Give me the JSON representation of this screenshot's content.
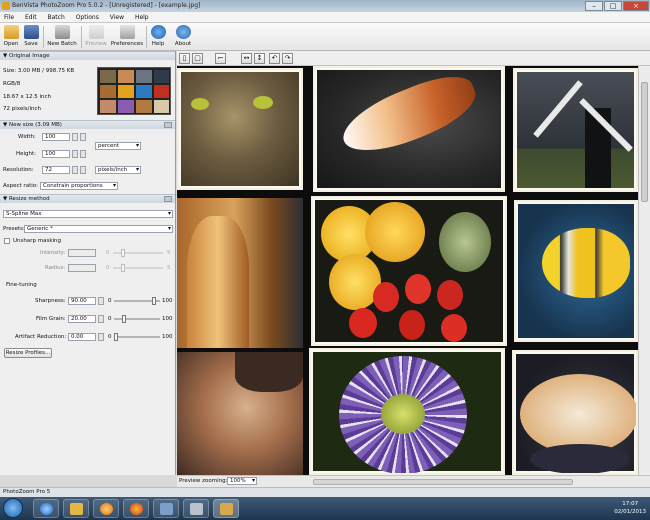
{
  "window": {
    "title": "BenVista PhotoZoom Pro 5.0.2 - [Unregistered] - [example.jpg]"
  },
  "menu": [
    "File",
    "Edit",
    "Batch",
    "Options",
    "View",
    "Help"
  ],
  "toolbar": {
    "open": "Open",
    "save": "Save",
    "new_batch": "New Batch",
    "preview": "Preview",
    "preferences": "Preferences",
    "help": "Help",
    "about": "About"
  },
  "original_image": {
    "header": "Original Image",
    "size": "Size: 3.00 MB / 998.75 KB",
    "mode": "RGB/8",
    "dimensions": "18.67 x 12.5 inch",
    "resolution": "72 pixels/inch"
  },
  "new_size": {
    "header": "New size (3.09 MB)",
    "width_label": "Width:",
    "width_value": "100",
    "width_unit": "percent",
    "height_label": "Height:",
    "height_value": "100",
    "resolution_label": "Resolution:",
    "resolution_value": "72",
    "resolution_unit": "pixels/inch",
    "aspect_label": "Aspect ratio:",
    "aspect_value": "Constrain proportions"
  },
  "resize_method": {
    "header": "Resize method",
    "method": "S-Spline Max",
    "presets_label": "Presets:",
    "presets_value": "Generic *",
    "unsharp_label": "Unsharp masking",
    "intensity_label": "Intensity:",
    "intensity_min": "0",
    "intensity_max": "5",
    "radius_label": "Radius:",
    "radius_min": "0",
    "radius_max": "5",
    "finetuning_label": "Fine-tuning",
    "sharpness_label": "Sharpness:",
    "sharpness_value": "90.00",
    "sharpness_min": "0",
    "sharpness_max": "100",
    "sharpness_level": 0.9,
    "filmgrain_label": "Film Grain:",
    "filmgrain_value": "20.00",
    "filmgrain_min": "0",
    "filmgrain_max": "100",
    "filmgrain_level": 0.2,
    "artifact_label": "Artifact Reduction:",
    "artifact_value": "0.00",
    "artifact_min": "0",
    "artifact_max": "100",
    "artifact_level": 0.0,
    "profiles_button": "Resize Profiles..."
  },
  "preview": {
    "label": "Preview zooming:",
    "zoom": "100%"
  },
  "status": "PhotoZoom Pro 5",
  "clock": {
    "time": "17:07",
    "date": "02/01/2013"
  }
}
